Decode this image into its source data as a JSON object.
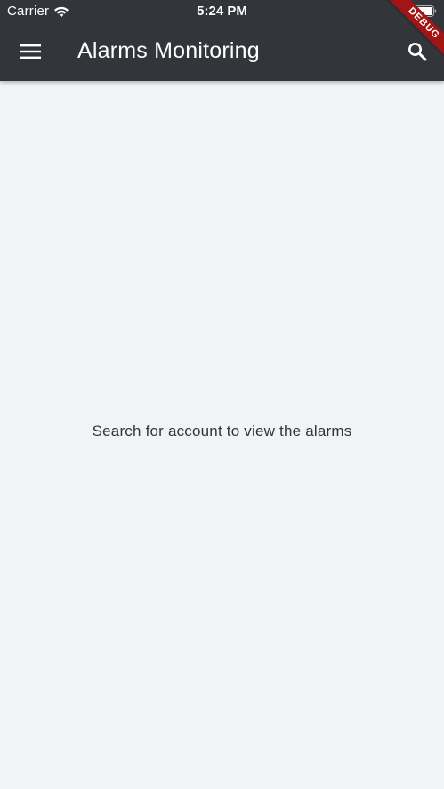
{
  "status_bar": {
    "carrier": "Carrier",
    "time": "5:24 PM"
  },
  "app_bar": {
    "title": "Alarms Monitoring",
    "menu_icon": "hamburger-menu-icon",
    "search_icon": "search-icon",
    "background_color": "#32363b"
  },
  "debug_banner": {
    "label": "DEBUG",
    "color": "#a31515"
  },
  "main": {
    "empty_message": "Search for account to view the alarms",
    "background_color": "#f2f3f5"
  }
}
